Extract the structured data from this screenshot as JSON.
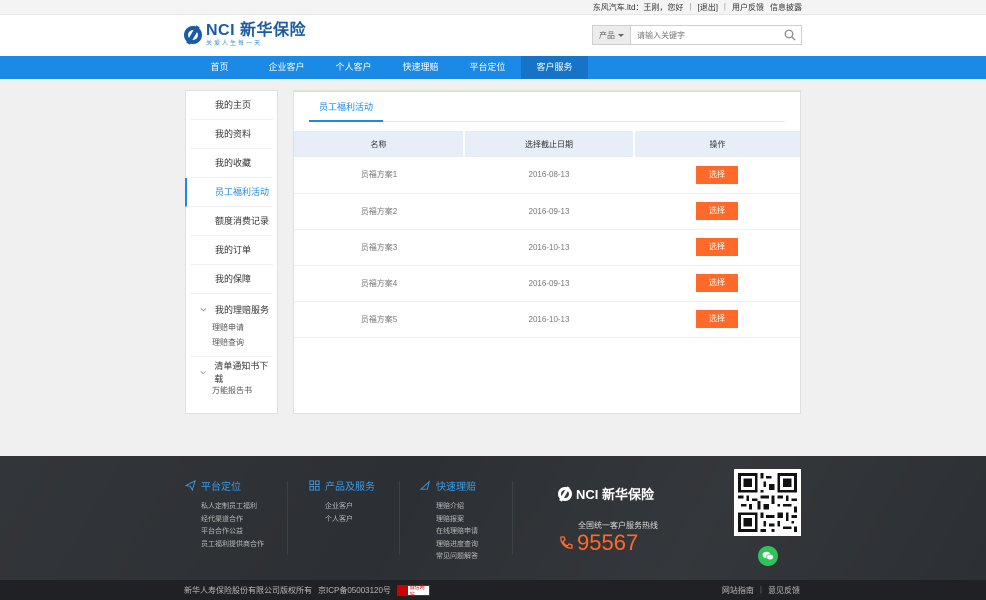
{
  "topbar": {
    "greeting": "东风汽车.ltd：王刚，您好",
    "logout": "[退出]",
    "feedback": "用户反馈",
    "disclosure": "信息披露"
  },
  "header": {
    "logo_text": "NCI 新华保险",
    "slogan": "关爱人生每一天",
    "search_category": "产品",
    "search_placeholder": "请输入关键字"
  },
  "nav": {
    "items": [
      "首页",
      "企业客户",
      "个人客户",
      "快速理赔",
      "平台定位",
      "客户服务"
    ],
    "active_index": 5
  },
  "sidebar": {
    "items": [
      "我的主页",
      "我的资料",
      "我的收藏",
      "员工福利活动",
      "额度消费记录",
      "我的订单",
      "我的保障"
    ],
    "active_index": 3,
    "groups": [
      {
        "title": "我的理赔服务",
        "subs": [
          "理赔申请",
          "理赔查询"
        ]
      },
      {
        "title": "清单通知书下载",
        "subs": [
          "万能报告书"
        ]
      }
    ]
  },
  "content": {
    "tab": "员工福利活动",
    "columns": [
      "名称",
      "选择截止日期",
      "操作"
    ],
    "rows": [
      {
        "name": "员福方案1",
        "date": "2016-08-13",
        "action": "选择"
      },
      {
        "name": "员福方案2",
        "date": "2016-09-13",
        "action": "选择"
      },
      {
        "name": "员福方案3",
        "date": "2016-10-13",
        "action": "选择"
      },
      {
        "name": "员福方案4",
        "date": "2016-09-13",
        "action": "选择"
      },
      {
        "name": "员福方案5",
        "date": "2016-10-13",
        "action": "选择"
      }
    ]
  },
  "footer": {
    "col1": {
      "title": "平台定位",
      "links": [
        "私人定制员工福利",
        "经代渠道合作",
        "平台合作公益",
        "员工福利提供商合作"
      ]
    },
    "col2": {
      "title": "产品及服务",
      "links": [
        "企业客户",
        "个人客户"
      ]
    },
    "col3": {
      "title": "快速理赔",
      "links": [
        "理赔介绍",
        "理赔报案",
        "在线理赔申请",
        "理赔进度查询",
        "常见问题解答"
      ]
    },
    "logo_text": "NCI 新华保险",
    "hotline_label": "全国统一客户服务热线",
    "hotline": "95567"
  },
  "bottom": {
    "copyright": "新华人寿保险股份有限公司版权所有",
    "icp": "京ICP备05003120号",
    "badge": "诚信网站",
    "links": [
      "网站指南",
      "意见反馈"
    ]
  },
  "colors": {
    "nav_blue": "#1b8ae6",
    "accent_orange": "#ff6a2b",
    "footer_dark": "#2c2f33"
  }
}
